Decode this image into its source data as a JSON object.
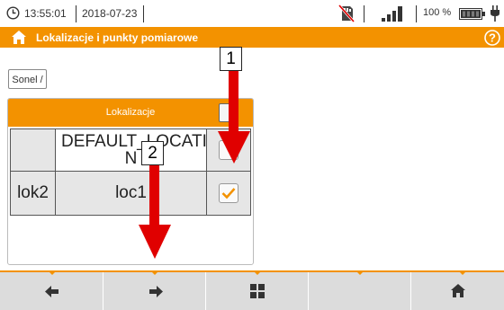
{
  "status": {
    "time": "13:55:01",
    "date": "2018-07-23",
    "battery": "100 %",
    "icons": [
      "clock-icon",
      "no-sd-card-icon",
      "signal-icon",
      "battery-icon",
      "power-plug-icon"
    ]
  },
  "title_bar": {
    "title": "Lokalizacje i punkty pomiarowe",
    "icons": [
      "home-icon",
      "help-icon"
    ]
  },
  "breadcrumb": "Sonel /",
  "table": {
    "header": "Lokalizacje",
    "rows": [
      {
        "col1": "",
        "col2": "DEFAULT_LOCATIO N",
        "checked": false
      },
      {
        "col1": "lok2",
        "col2": "loc1",
        "checked": true
      }
    ]
  },
  "callouts": [
    "1",
    "2"
  ],
  "nav": {
    "icons": [
      "arrow-left-icon",
      "arrow-right-icon",
      "grid-icon",
      "",
      "home-icon"
    ]
  },
  "colors": {
    "accent": "#f39200",
    "arrow": "#e00000"
  }
}
